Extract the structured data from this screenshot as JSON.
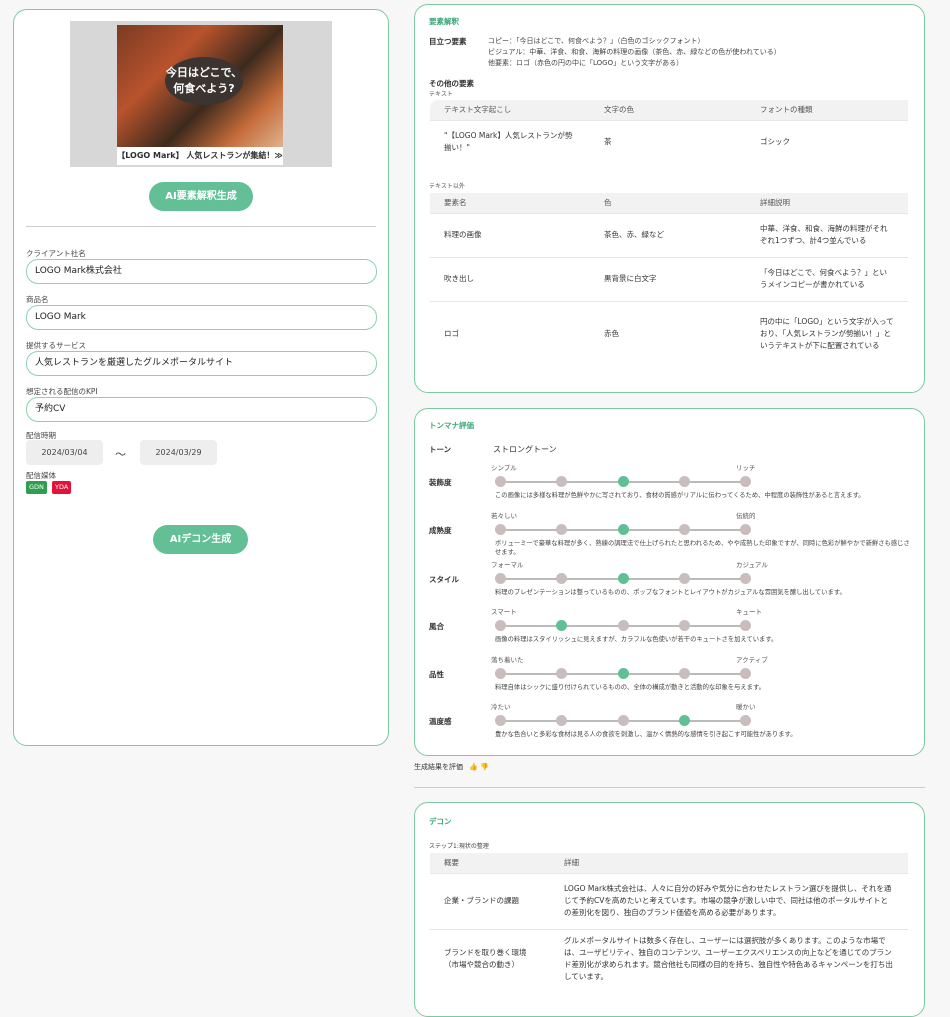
{
  "left": {
    "banner": {
      "headline": "今日はどこで、何食べよう?",
      "footer": "【LOGO Mark】 人気レストランが集結！≫"
    },
    "analysis_button": "AI要素解釈生成",
    "fields": [
      {
        "label": "クライアント社名",
        "value": "LOGO Mark株式会社"
      },
      {
        "label": "商品名",
        "value": "LOGO Mark"
      },
      {
        "label": "提供するサービス",
        "value": "人気レストランを厳選したグルメポータルサイト"
      },
      {
        "label": "想定される配信のKPI",
        "value": "予約CV"
      }
    ],
    "period_label": "配信時期",
    "period_start": "2024/03/04",
    "period_sep": "〜",
    "period_end": "2024/03/29",
    "media_label": "配信媒体",
    "media_tags": [
      {
        "name": "GDN",
        "color": "#2f9e4f"
      },
      {
        "name": "YDA",
        "color": "#e2123a"
      }
    ],
    "decon_button": "AIデコン生成"
  },
  "analysis": {
    "title": "要素解釈",
    "main_label": "目立つ要素",
    "main_lines": [
      "コピー：「今日はどこで、何食べよう？」（白色のゴシックフォント）",
      "ビジュアル：中華、洋食、和食、海鮮の料理の画像（茶色、赤、緑などの色が使われている）",
      "他要素：ロゴ（赤色の円の中に「LOGO」という文字がある）"
    ],
    "other_label": "その他の要素",
    "text_label": "テキスト",
    "text_headers": [
      "テキスト文字起こし",
      "文字の色",
      "フォントの種類"
    ],
    "text_rows": [
      [
        "\"【LOGO Mark】人気レストランが勢揃い！\"",
        "茶",
        "ゴシック"
      ]
    ],
    "nontext_label": "テキスト以外",
    "nontext_headers": [
      "要素名",
      "色",
      "詳細説明"
    ],
    "nontext_rows": [
      [
        "料理の画像",
        "茶色、赤、緑など",
        "中華、洋食、和食、海鮮の料理がそれぞれ1つずつ、計4つ並んでいる"
      ],
      [
        "吹き出し",
        "黒背景に白文字",
        "「今日はどこで、何食べよう？」というメインコピーが書かれている"
      ],
      [
        "ロゴ",
        "赤色",
        "円の中に「LOGO」という文字が入っており、「人気レストランが勢揃い！」というテキストが下に配置されている"
      ]
    ]
  },
  "tone": {
    "title": "トンマナ評価",
    "tone_label": "トーン",
    "tone_value": "ストロングトーン",
    "rows": [
      {
        "label": "装飾度",
        "left": "シンプル",
        "right": "リッチ",
        "level": 3,
        "desc": "この画像には多様な料理が色鮮やかに写されており、食材の質感がリアルに伝わってくるため、中程度の装飾性があると言えます。"
      },
      {
        "label": "成熟度",
        "left": "若々しい",
        "right": "伝統的",
        "level": 3,
        "desc": "ボリューミーで豪華な料理が多く、熟練の調理法で仕上げられたと思われるため、やや成熟した印象ですが、同時に色彩が鮮やかで新鮮さも感じさせます。"
      },
      {
        "label": "スタイル",
        "left": "フォーマル",
        "right": "カジュアル",
        "level": 3,
        "desc": "料理のプレゼンテーションは整っているものの、ポップなフォントとレイアウトがカジュアルな雰囲気を醸し出しています。"
      },
      {
        "label": "風合",
        "left": "スマート",
        "right": "キュート",
        "level": 2,
        "desc": "画像の料理はスタイリッシュに見えますが、カラフルな色使いが若干のキュートさを加えています。"
      },
      {
        "label": "品性",
        "left": "落ち着いた",
        "right": "アクティブ",
        "level": 3,
        "desc": "料理自体はシックに盛り付けられているものの、全体の構成が動きと活動的な印象を与えます。"
      },
      {
        "label": "温度感",
        "left": "冷たい",
        "right": "暖かい",
        "level": 4,
        "desc": "豊かな色合いと多彩な食材は見る人の食欲を刺激し、温かく情熱的な感情を引き起こす可能性があります。"
      }
    ],
    "feedback": "生成結果を評価"
  },
  "decon": {
    "title": "デコン",
    "step": "ステップ1:現状の整理",
    "headers": [
      "概要",
      "詳細"
    ],
    "rows": [
      [
        "企業・ブランドの課題",
        "LOGO Mark株式会社は、人々に自分の好みや気分に合わせたレストラン選びを提供し、それを通じて予約CVを高めたいと考えています。市場の競争が激しい中で、同社は他のポータルサイトとの差別化を図り、独自のブランド価値を高める必要があります。"
      ],
      [
        "ブランドを取り巻く環境\n（市場や競合の動き）",
        "グルメポータルサイトは数多く存在し、ユーザーには選択肢が多くあります。このような市場では、ユーザビリティ、独自のコンテンツ、ユーザーエクスペリエンスの向上などを通じてのブランド差別化が求められます。競合他社も同様の目的を持ち、独自性や特色あるキャンペーンを打ち出しています。"
      ]
    ]
  }
}
